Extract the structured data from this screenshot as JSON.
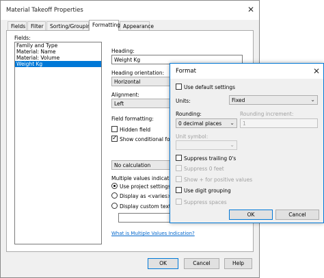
{
  "main_window": {
    "title": "Material Takeoff Properties",
    "tabs": [
      {
        "label": "Fields"
      },
      {
        "label": "Filter"
      },
      {
        "label": "Sorting/Grouping"
      },
      {
        "label": "Formatting"
      },
      {
        "label": "Appearance"
      }
    ],
    "fields_label": "Fields:",
    "fields": [
      "Family and Type",
      "Material: Name",
      "Material: Volume",
      "Weight Kg"
    ],
    "heading_label": "Heading:",
    "heading_value": "Weight Kg",
    "heading_orientation_label": "Heading orientation:",
    "heading_orientation_value": "Horizontal",
    "alignment_label": "Alignment:",
    "alignment_value": "Left",
    "field_formatting_label": "Field formatting:",
    "hidden_field_label": "Hidden field",
    "show_conditional_label": "Show conditional forma",
    "calculation_value": "No calculation",
    "multiple_values_label": "Multiple values indication",
    "radio_project": "Use project settings",
    "radio_varies": "Display as <varies>",
    "radio_custom": "Display custom text:",
    "help_link": "What is Multiple Values Indication?",
    "buttons": {
      "ok": "OK",
      "cancel": "Cancel",
      "help": "Help"
    }
  },
  "format_dialog": {
    "title": "Format",
    "use_default_label": "Use default settings",
    "units_label": "Units:",
    "units_value": "Fixed",
    "rounding_label": "Rounding:",
    "rounding_value": "0 decimal places",
    "rounding_increment_label": "Rounding increment:",
    "rounding_increment_value": "1",
    "unit_symbol_label": "Unit symbol:",
    "suppress_trailing_label": "Suppress trailing 0's",
    "suppress_feet_label": "Suppress 0 feet",
    "show_plus_label": "Show + for positive values",
    "digit_grouping_label": "Use digit grouping",
    "suppress_spaces_label": "Suppress spaces",
    "buttons": {
      "ok": "OK",
      "cancel": "Cancel"
    }
  },
  "icons": {
    "close": "close-icon",
    "dropdown": "chevron-down-icon"
  },
  "colors": {
    "accent": "#0078d7",
    "link": "#0066cc",
    "selection": "#0078d7"
  }
}
